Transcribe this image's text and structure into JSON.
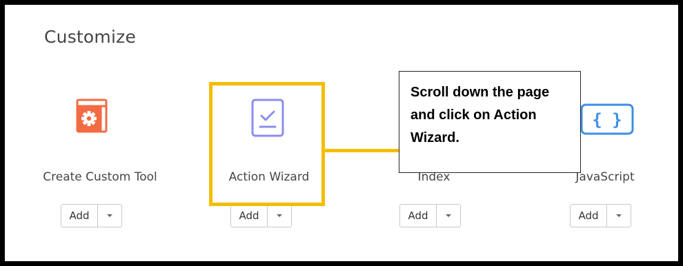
{
  "section": {
    "title": "Customize"
  },
  "tools": [
    {
      "label": "Create Custom Tool",
      "icon": "custom-tool-gear-icon",
      "color": "#f26b43"
    },
    {
      "label": "Action Wizard",
      "icon": "action-wizard-checklist-icon",
      "color": "#8c8cf0"
    },
    {
      "label": "Index",
      "icon": "index-icon",
      "color": "#777777"
    },
    {
      "label": "JavaScript",
      "icon": "javascript-braces-icon",
      "color": "#3b8fe8"
    }
  ],
  "buttons": {
    "add_label": "Add",
    "dropdown_icon": "caret-down-icon"
  },
  "annotation": {
    "callout_text": "Scroll down the page and click on Action Wizard.",
    "highlight_color": "#f5bd00"
  }
}
